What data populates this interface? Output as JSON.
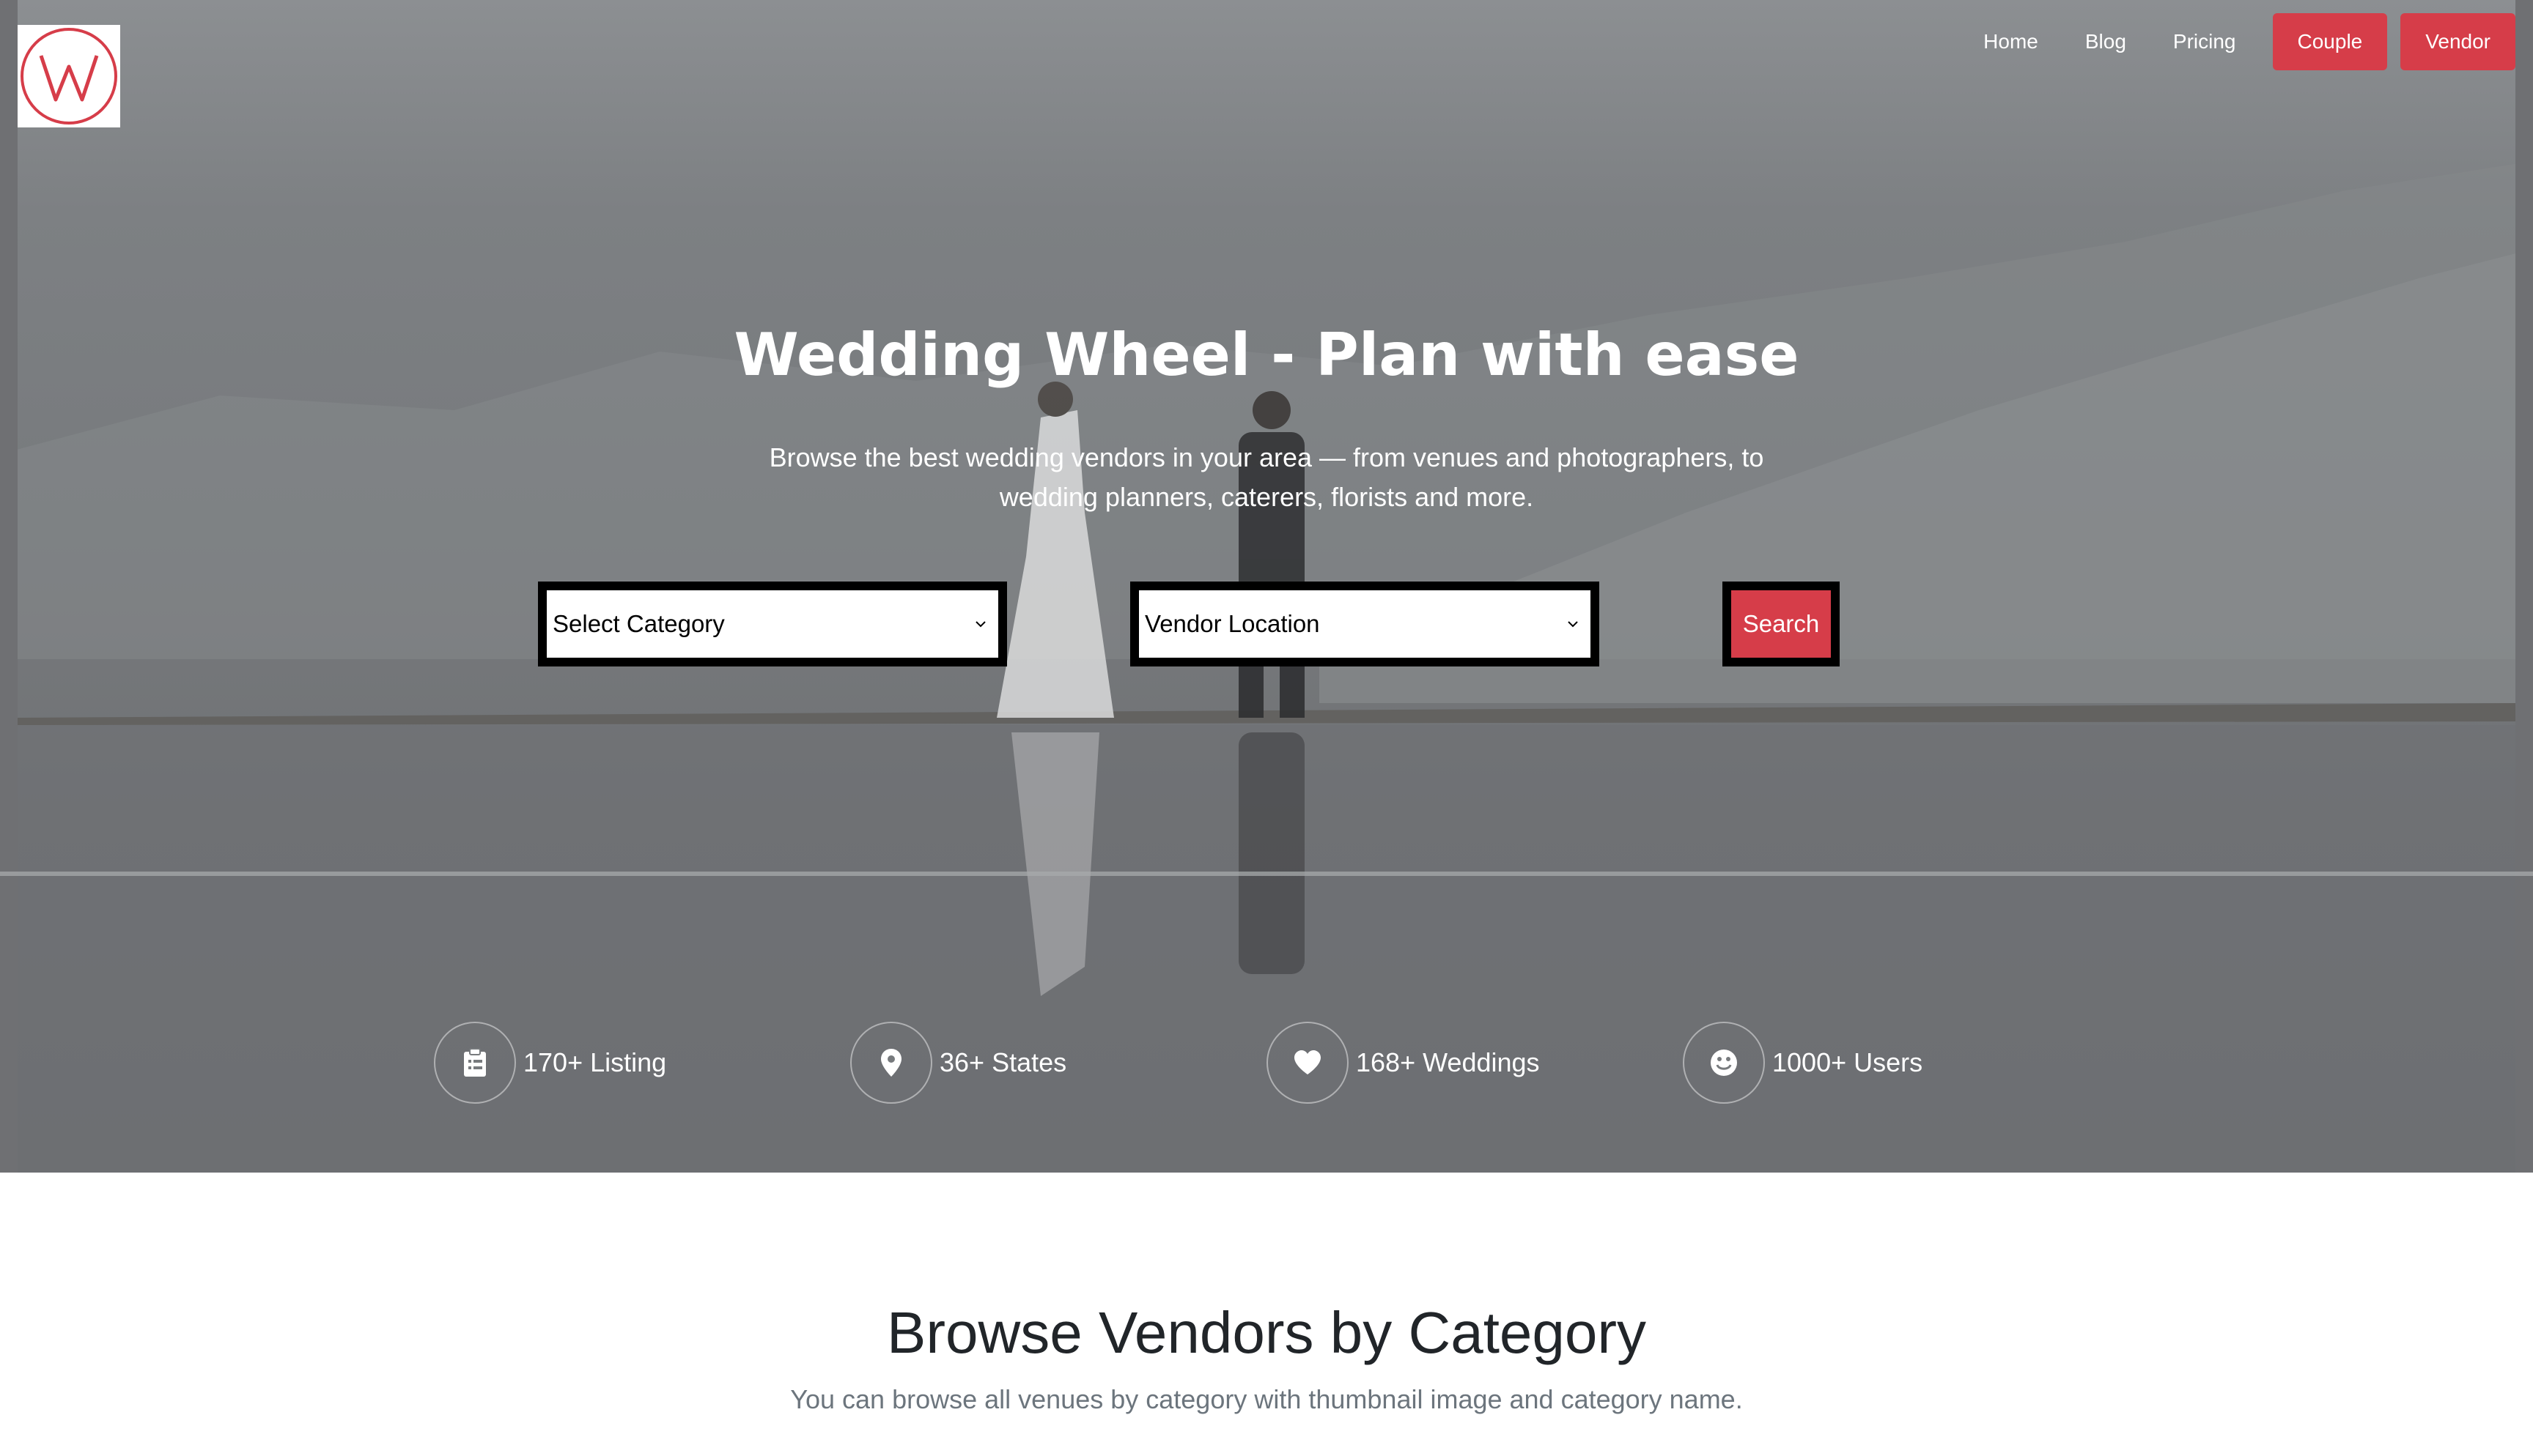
{
  "header": {
    "logo_icon": "wedding-wheel-w-logo",
    "nav": {
      "home": "Home",
      "blog": "Blog",
      "pricing": "Pricing",
      "couple": "Couple",
      "vendor": "Vendor"
    }
  },
  "hero": {
    "title": "Wedding Wheel - Plan with ease",
    "subtitle_line1": "Browse the best wedding vendors in your area — from venues and photographers, to",
    "subtitle_line2": "wedding planners, caterers, florists and more.",
    "search": {
      "category_selected": "Select Category",
      "location_selected": "Vendor Location",
      "button_label": "Search"
    },
    "stats": [
      {
        "icon": "clipboard-icon",
        "label": "170+ Listing"
      },
      {
        "icon": "map-pin-icon",
        "label": "36+ States"
      },
      {
        "icon": "heart-icon",
        "label": "168+ Weddings"
      },
      {
        "icon": "smiley-icon",
        "label": "1000+ Users"
      }
    ]
  },
  "categories_section": {
    "title": "Browse Vendors by Category",
    "subtitle": "You can browse all venues by category with thumbnail image and category name."
  },
  "colors": {
    "accent": "#d63d49",
    "hero_overlay": "#777a7d",
    "text_dark": "#212529",
    "text_muted": "#6c757d"
  }
}
